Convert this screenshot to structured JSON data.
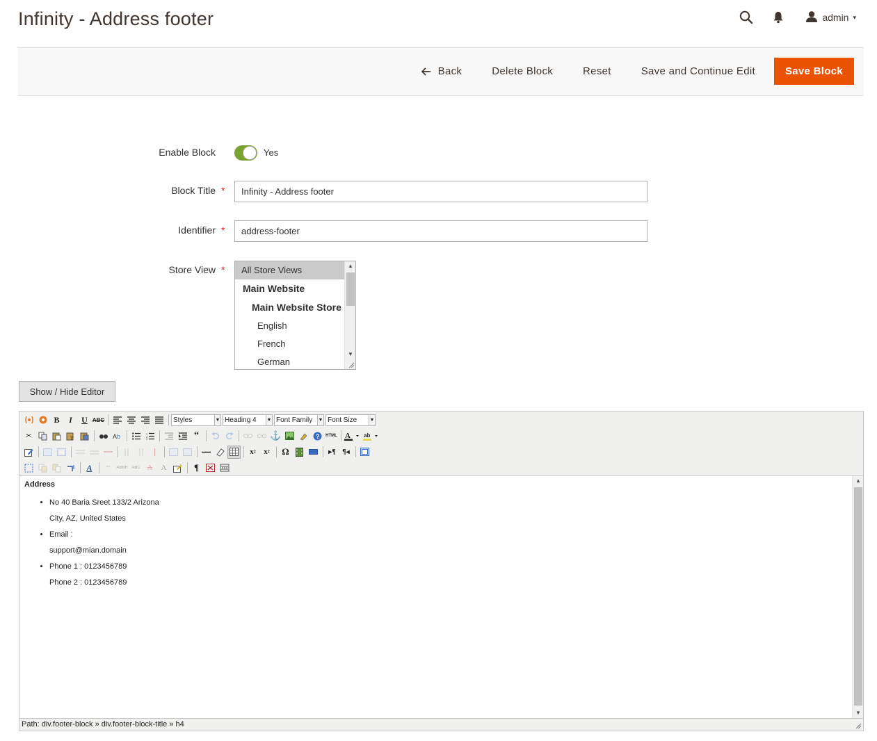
{
  "page": {
    "title": "Infinity - Address footer"
  },
  "header": {
    "search_icon": "search-icon",
    "notifications_icon": "bell-icon",
    "user_icon": "user-icon",
    "username": "admin",
    "dropdown_caret": "▾"
  },
  "actions": {
    "back": "Back",
    "delete": "Delete Block",
    "reset": "Reset",
    "save_continue": "Save and Continue Edit",
    "save": "Save Block",
    "save_color": "#eb5202"
  },
  "form": {
    "enable_label": "Enable Block",
    "enable_value": "Yes",
    "enabled": true,
    "toggle_color": "#79a22e",
    "title_label": "Block Title",
    "title_value": "Infinity - Address footer",
    "identifier_label": "Identifier",
    "identifier_value": "address-footer",
    "store_view_label": "Store View",
    "required_mark": "*",
    "store_options": [
      {
        "label": "All Store Views",
        "selected": true
      },
      {
        "label": "Main Website",
        "group": true
      },
      {
        "label": "Main Website Store",
        "group": true
      },
      {
        "label": "English"
      },
      {
        "label": "French"
      },
      {
        "label": "German"
      }
    ]
  },
  "editor": {
    "toggle_label": "Show / Hide Editor",
    "styles_value": "Styles",
    "format_value": "Heading 4",
    "font_family_value": "Font Family",
    "font_size_value": "Font Size",
    "content": {
      "heading": "Address",
      "items": [
        [
          "No 40 Baria Sreet 133/2 Arizona",
          "City, AZ, United States"
        ],
        [
          "Email :",
          "support@mian.domain"
        ],
        [
          "Phone 1 : 0123456789",
          "Phone 2 : 0123456789"
        ]
      ]
    },
    "path_label": "Path:",
    "path": "div.footer-block » div.footer-block-title » h4"
  }
}
